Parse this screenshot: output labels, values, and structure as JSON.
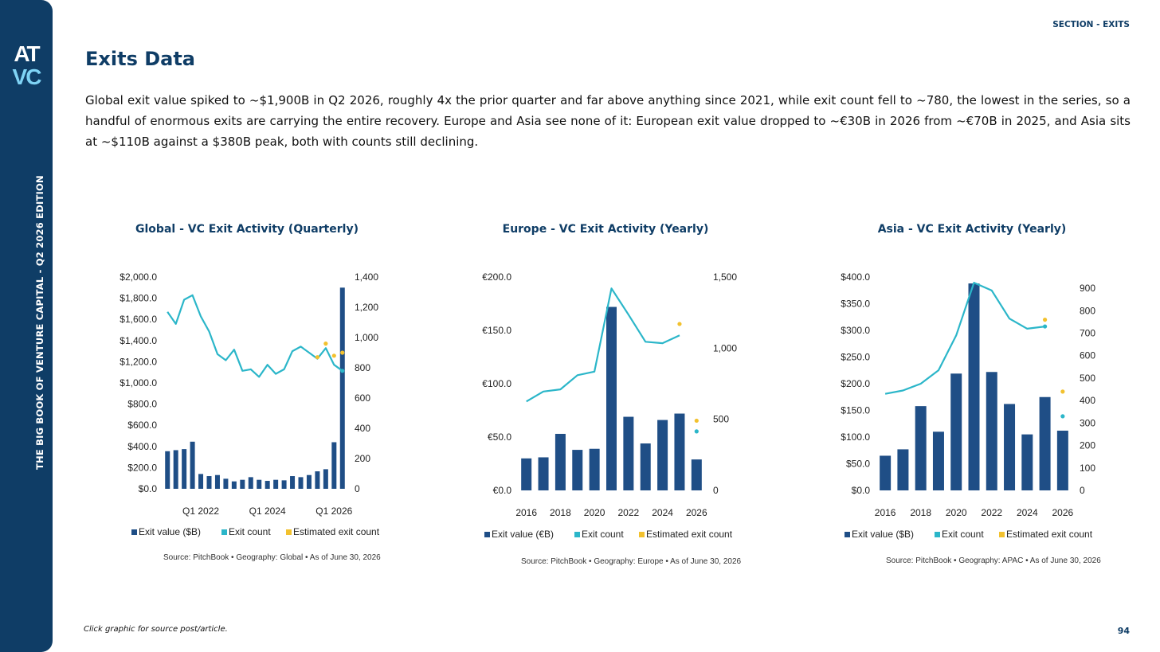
{
  "sidebar": {
    "logo_top": "AT",
    "logo_bottom": "VC",
    "vertical_text": "THE BIG BOOK OF VENTURE CAPITAL - Q2 2026 EDITION"
  },
  "header": {
    "section": "SECTION - EXITS",
    "title": "Exits Data"
  },
  "description": "Global exit value spiked to ~$1,900B in Q2 2026, roughly 4x the prior quarter and far above anything since 2021, while exit count fell to ~780, the lowest in the series, so a handful of enormous exits are carrying the entire recovery. Europe and Asia see none of it: European exit value dropped to ~€30B in 2026 from ~€70B in 2025, and Asia sits at ~$110B against a $380B peak, both with counts still declining.",
  "footer": {
    "note": "Click graphic for source post/article.",
    "page": "94"
  },
  "colors": {
    "bar": "#1f4e86",
    "line": "#2bb6c9",
    "estimated": "#f2c12e",
    "brand": "#0f3d66"
  },
  "chart_data": [
    {
      "type": "bar",
      "title": "Global - VC Exit Activity (Quarterly)",
      "source": "Source: PitchBook • Geography: Global • As of June 30, 2026",
      "legend": [
        "Exit value ($B)",
        "Exit count",
        "Estimated exit count"
      ],
      "x_tick_labels": [
        "Q1 2022",
        "Q1 2024",
        "Q1 2026"
      ],
      "x_tick_index": [
        4,
        12,
        20
      ],
      "left_axis": {
        "ylim": [
          0,
          2000
        ],
        "ticks": [
          "$0.0",
          "$200.0",
          "$400.0",
          "$600.0",
          "$800.0",
          "$1,000.0",
          "$1,200.0",
          "$1,400.0",
          "$1,600.0",
          "$1,800.0",
          "$2,000.0"
        ]
      },
      "right_axis": {
        "ylim": [
          0,
          1400
        ],
        "ticks": [
          "0",
          "200",
          "400",
          "600",
          "800",
          "1,000",
          "1,200",
          "1,400"
        ]
      },
      "exit_value": [
        355,
        365,
        375,
        445,
        140,
        120,
        130,
        95,
        70,
        85,
        110,
        85,
        75,
        85,
        80,
        120,
        110,
        130,
        165,
        185,
        440,
        1900
      ],
      "exit_count": [
        1170,
        1090,
        1250,
        1280,
        1140,
        1040,
        890,
        850,
        920,
        780,
        790,
        740,
        820,
        760,
        790,
        910,
        940,
        900,
        860,
        930,
        820,
        780
      ],
      "estimated_count": [
        null,
        null,
        null,
        null,
        null,
        null,
        null,
        null,
        null,
        null,
        null,
        null,
        null,
        null,
        null,
        null,
        null,
        null,
        870,
        960,
        880,
        900
      ],
      "estimated_markers": [
        {
          "i": 18,
          "v": 870,
          "c": "estimated"
        },
        {
          "i": 19,
          "v": 960,
          "c": "estimated"
        },
        {
          "i": 20,
          "v": 880,
          "c": "estimated"
        },
        {
          "i": 21,
          "v": 900,
          "c": "estimated"
        },
        {
          "i": 21,
          "v": 780,
          "c": "line"
        }
      ]
    },
    {
      "type": "bar",
      "title": "Europe - VC Exit Activity (Yearly)",
      "source": "Source: PitchBook • Geography: Europe • As of June 30, 2026",
      "legend": [
        "Exit value (€B)",
        "Exit count",
        "Estimated exit count"
      ],
      "x_tick_labels": [
        "2016",
        "2018",
        "2020",
        "2022",
        "2024",
        "2026"
      ],
      "x_tick_index": [
        0,
        2,
        4,
        6,
        8,
        10
      ],
      "left_axis": {
        "ylim": [
          0,
          200
        ],
        "ticks": [
          "€0.0",
          "€50.0",
          "€100.0",
          "€150.0",
          "€200.0"
        ]
      },
      "right_axis": {
        "ylim": [
          0,
          1500
        ],
        "ticks": [
          "0",
          "500",
          "1,000",
          "1,500"
        ]
      },
      "exit_value": [
        30,
        31,
        53,
        38,
        39,
        172,
        69,
        44,
        66,
        72,
        29
      ],
      "exit_count": [
        625,
        695,
        710,
        810,
        835,
        1420,
        1235,
        1045,
        1035,
        1090,
        null
      ],
      "estimated_markers": [
        {
          "i": 9,
          "v": 1170,
          "c": "estimated"
        },
        {
          "i": 10,
          "v": 490,
          "c": "estimated"
        },
        {
          "i": 10,
          "v": 415,
          "c": "line"
        }
      ]
    },
    {
      "type": "bar",
      "title": "Asia - VC Exit Activity (Yearly)",
      "source": "Source: PitchBook • Geography: APAC • As of June 30, 2026",
      "legend": [
        "Exit value ($B)",
        "Exit count",
        "Estimated exit count"
      ],
      "x_tick_labels": [
        "2016",
        "2018",
        "2020",
        "2022",
        "2024",
        "2026"
      ],
      "x_tick_index": [
        0,
        2,
        4,
        6,
        8,
        10
      ],
      "left_axis": {
        "ylim": [
          0,
          400
        ],
        "ticks": [
          "$0.0",
          "$50.0",
          "$100.0",
          "$150.0",
          "$200.0",
          "$250.0",
          "$300.0",
          "$350.0",
          "$400.0"
        ]
      },
      "right_axis": {
        "ylim": [
          0,
          950
        ],
        "ticks": [
          "0",
          "100",
          "200",
          "300",
          "400",
          "500",
          "600",
          "700",
          "800",
          "900"
        ]
      },
      "exit_value": [
        65,
        77,
        158,
        110,
        219,
        388,
        222,
        162,
        105,
        175,
        112
      ],
      "exit_count": [
        430,
        445,
        475,
        535,
        690,
        925,
        890,
        765,
        720,
        730,
        null
      ],
      "estimated_markers": [
        {
          "i": 9,
          "v": 760,
          "c": "estimated"
        },
        {
          "i": 9,
          "v": 730,
          "c": "line"
        },
        {
          "i": 10,
          "v": 440,
          "c": "estimated"
        },
        {
          "i": 10,
          "v": 330,
          "c": "line"
        }
      ]
    }
  ]
}
